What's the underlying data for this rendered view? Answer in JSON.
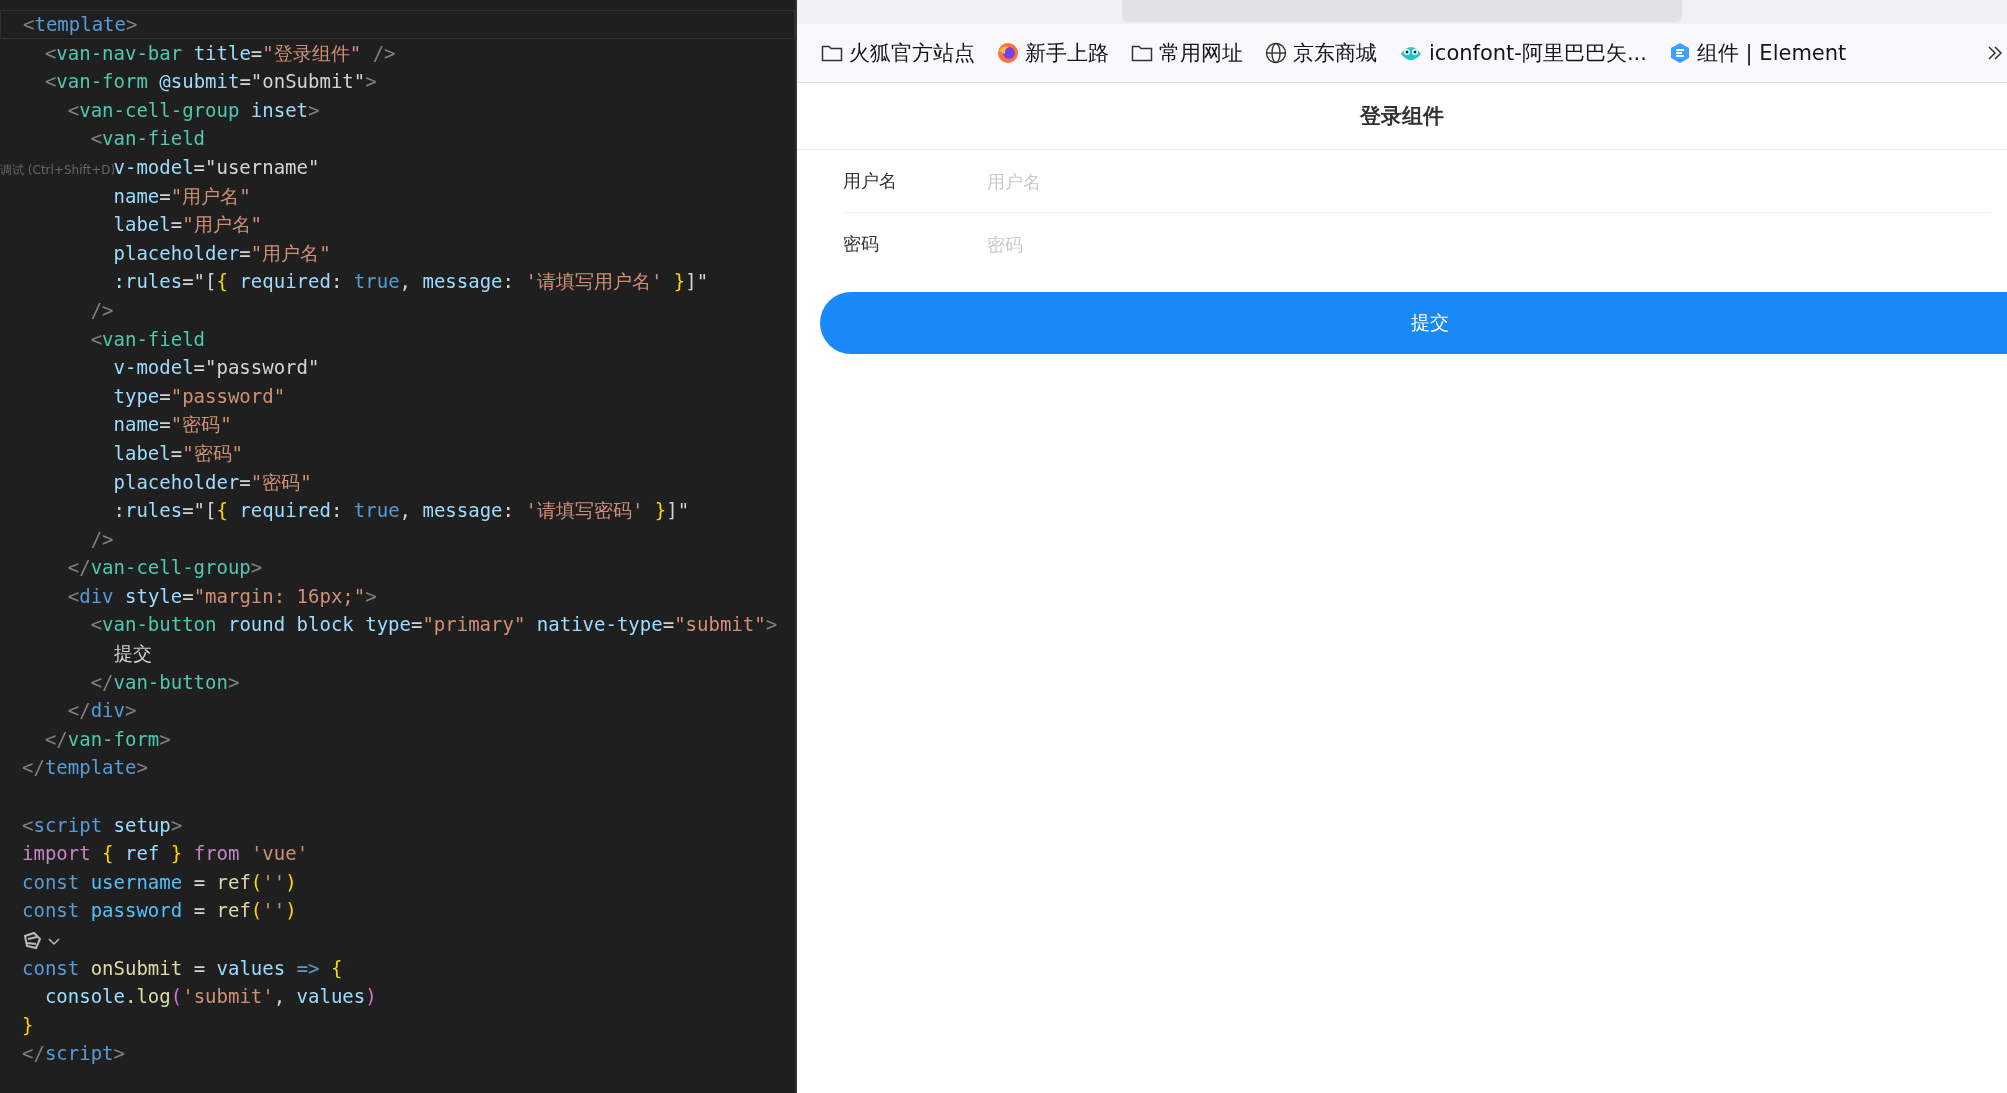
{
  "editor": {
    "tooltip": "调试 (Ctrl+Shift+D)",
    "lines": [
      {
        "current": true,
        "tokens": [
          {
            "kind": "punct",
            "text": "<"
          },
          {
            "kind": "tagb",
            "text": "template"
          },
          {
            "kind": "punct",
            "text": ">"
          }
        ]
      },
      {
        "tokens": [
          {
            "kind": "punct",
            "text": "  <"
          },
          {
            "kind": "tag",
            "text": "van-nav-bar"
          },
          {
            "kind": "attr",
            "text": " title"
          },
          {
            "kind": "plain",
            "text": "="
          },
          {
            "kind": "str",
            "text": "\"登录组件\""
          },
          {
            "kind": "punct",
            "text": " />"
          }
        ]
      },
      {
        "tokens": [
          {
            "kind": "punct",
            "text": "  <"
          },
          {
            "kind": "tag",
            "text": "van-form"
          },
          {
            "kind": "attr",
            "text": " @submit"
          },
          {
            "kind": "plain",
            "text": "=\"onSubmit\""
          },
          {
            "kind": "punct",
            "text": ">"
          }
        ]
      },
      {
        "tokens": [
          {
            "kind": "punct",
            "text": "    <"
          },
          {
            "kind": "tag",
            "text": "van-cell-group"
          },
          {
            "kind": "attr",
            "text": " inset"
          },
          {
            "kind": "punct",
            "text": ">"
          }
        ]
      },
      {
        "tokens": [
          {
            "kind": "punct",
            "text": "      <"
          },
          {
            "kind": "tag",
            "text": "van-field"
          }
        ]
      },
      {
        "tokens": [
          {
            "kind": "attr",
            "text": "        v-model"
          },
          {
            "kind": "plain",
            "text": "=\"username\""
          }
        ]
      },
      {
        "tokens": [
          {
            "kind": "attr",
            "text": "        name"
          },
          {
            "kind": "plain",
            "text": "="
          },
          {
            "kind": "str",
            "text": "\"用户名\""
          }
        ]
      },
      {
        "tokens": [
          {
            "kind": "attr",
            "text": "        label"
          },
          {
            "kind": "plain",
            "text": "="
          },
          {
            "kind": "str",
            "text": "\"用户名\""
          }
        ]
      },
      {
        "tokens": [
          {
            "kind": "attr",
            "text": "        placeholder"
          },
          {
            "kind": "plain",
            "text": "="
          },
          {
            "kind": "str",
            "text": "\"用户名\""
          }
        ]
      },
      {
        "tokens": [
          {
            "kind": "attr",
            "text": "        :rules"
          },
          {
            "kind": "plain",
            "text": "=\"["
          },
          {
            "kind": "brace",
            "text": "{"
          },
          {
            "kind": "attr",
            "text": " required"
          },
          {
            "kind": "plain",
            "text": ":"
          },
          {
            "kind": "kw",
            "text": " true"
          },
          {
            "kind": "plain",
            "text": ","
          },
          {
            "kind": "attr",
            "text": " message"
          },
          {
            "kind": "plain",
            "text": ":"
          },
          {
            "kind": "str",
            "text": " '请填写用户名'"
          },
          {
            "kind": "brace",
            "text": " }"
          },
          {
            "kind": "plain",
            "text": "]\""
          }
        ]
      },
      {
        "tokens": [
          {
            "kind": "punct",
            "text": "      />"
          }
        ]
      },
      {
        "tokens": [
          {
            "kind": "punct",
            "text": "      <"
          },
          {
            "kind": "tag",
            "text": "van-field"
          }
        ]
      },
      {
        "tokens": [
          {
            "kind": "attr",
            "text": "        v-model"
          },
          {
            "kind": "plain",
            "text": "=\"password\""
          }
        ]
      },
      {
        "tokens": [
          {
            "kind": "attr",
            "text": "        type"
          },
          {
            "kind": "plain",
            "text": "="
          },
          {
            "kind": "str",
            "text": "\"password\""
          }
        ]
      },
      {
        "tokens": [
          {
            "kind": "attr",
            "text": "        name"
          },
          {
            "kind": "plain",
            "text": "="
          },
          {
            "kind": "str",
            "text": "\"密码\""
          }
        ]
      },
      {
        "tokens": [
          {
            "kind": "attr",
            "text": "        label"
          },
          {
            "kind": "plain",
            "text": "="
          },
          {
            "kind": "str",
            "text": "\"密码\""
          }
        ]
      },
      {
        "tokens": [
          {
            "kind": "attr",
            "text": "        placeholder"
          },
          {
            "kind": "plain",
            "text": "="
          },
          {
            "kind": "str",
            "text": "\"密码\""
          }
        ]
      },
      {
        "tokens": [
          {
            "kind": "attr",
            "text": "        :rules"
          },
          {
            "kind": "plain",
            "text": "=\"["
          },
          {
            "kind": "brace",
            "text": "{"
          },
          {
            "kind": "attr",
            "text": " required"
          },
          {
            "kind": "plain",
            "text": ":"
          },
          {
            "kind": "kw",
            "text": " true"
          },
          {
            "kind": "plain",
            "text": ","
          },
          {
            "kind": "attr",
            "text": " message"
          },
          {
            "kind": "plain",
            "text": ":"
          },
          {
            "kind": "str",
            "text": " '请填写密码'"
          },
          {
            "kind": "brace",
            "text": " }"
          },
          {
            "kind": "plain",
            "text": "]\""
          }
        ]
      },
      {
        "tokens": [
          {
            "kind": "punct",
            "text": "      />"
          }
        ]
      },
      {
        "tokens": [
          {
            "kind": "punct",
            "text": "    </"
          },
          {
            "kind": "tag",
            "text": "van-cell-group"
          },
          {
            "kind": "punct",
            "text": ">"
          }
        ]
      },
      {
        "tokens": [
          {
            "kind": "punct",
            "text": "    <"
          },
          {
            "kind": "tagb",
            "text": "div"
          },
          {
            "kind": "attr",
            "text": " style"
          },
          {
            "kind": "plain",
            "text": "="
          },
          {
            "kind": "str",
            "text": "\"margin: 16px;\""
          },
          {
            "kind": "punct",
            "text": ">"
          }
        ]
      },
      {
        "tokens": [
          {
            "kind": "punct",
            "text": "      <"
          },
          {
            "kind": "tag",
            "text": "van-button"
          },
          {
            "kind": "attr",
            "text": " round block type"
          },
          {
            "kind": "plain",
            "text": "="
          },
          {
            "kind": "str",
            "text": "\"primary\""
          },
          {
            "kind": "attr",
            "text": " native-type"
          },
          {
            "kind": "plain",
            "text": "="
          },
          {
            "kind": "str",
            "text": "\"submit\""
          },
          {
            "kind": "punct",
            "text": ">"
          }
        ]
      },
      {
        "tokens": [
          {
            "kind": "plain",
            "text": "        提交"
          }
        ]
      },
      {
        "tokens": [
          {
            "kind": "punct",
            "text": "      </"
          },
          {
            "kind": "tag",
            "text": "van-button"
          },
          {
            "kind": "punct",
            "text": ">"
          }
        ]
      },
      {
        "tokens": [
          {
            "kind": "punct",
            "text": "    </"
          },
          {
            "kind": "tagb",
            "text": "div"
          },
          {
            "kind": "punct",
            "text": ">"
          }
        ]
      },
      {
        "tokens": [
          {
            "kind": "punct",
            "text": "  </"
          },
          {
            "kind": "tag",
            "text": "van-form"
          },
          {
            "kind": "punct",
            "text": ">"
          }
        ]
      },
      {
        "tokens": [
          {
            "kind": "punct",
            "text": "</"
          },
          {
            "kind": "tagb",
            "text": "template"
          },
          {
            "kind": "punct",
            "text": ">"
          }
        ]
      },
      {
        "kind": "blank"
      },
      {
        "tokens": [
          {
            "kind": "punct",
            "text": "<"
          },
          {
            "kind": "tagb",
            "text": "script"
          },
          {
            "kind": "attr",
            "text": " setup"
          },
          {
            "kind": "punct",
            "text": ">"
          }
        ]
      },
      {
        "tokens": [
          {
            "kind": "imp",
            "text": "import"
          },
          {
            "kind": "brace",
            "text": " {"
          },
          {
            "kind": "attr",
            "text": " ref"
          },
          {
            "kind": "brace",
            "text": " }"
          },
          {
            "kind": "imp",
            "text": " from"
          },
          {
            "kind": "str",
            "text": " 'vue'"
          }
        ]
      },
      {
        "tokens": [
          {
            "kind": "kw",
            "text": "const"
          },
          {
            "kind": "var",
            "text": " username"
          },
          {
            "kind": "plain",
            "text": " ="
          },
          {
            "kind": "fn",
            "text": " ref"
          },
          {
            "kind": "brace",
            "text": "("
          },
          {
            "kind": "str",
            "text": "''"
          },
          {
            "kind": "brace",
            "text": ")"
          }
        ]
      },
      {
        "tokens": [
          {
            "kind": "kw",
            "text": "const"
          },
          {
            "kind": "var",
            "text": " password"
          },
          {
            "kind": "plain",
            "text": " ="
          },
          {
            "kind": "fn",
            "text": " ref"
          },
          {
            "kind": "brace",
            "text": "("
          },
          {
            "kind": "str",
            "text": "''"
          },
          {
            "kind": "brace",
            "text": ")"
          }
        ]
      },
      {
        "kind": "lens"
      },
      {
        "tokens": [
          {
            "kind": "kw",
            "text": "const"
          },
          {
            "kind": "fn",
            "text": " onSubmit"
          },
          {
            "kind": "plain",
            "text": " ="
          },
          {
            "kind": "attr",
            "text": " values"
          },
          {
            "kind": "kw",
            "text": " =>"
          },
          {
            "kind": "brace",
            "text": " {"
          }
        ]
      },
      {
        "tokens": [
          {
            "kind": "attr",
            "text": "  console"
          },
          {
            "kind": "fn",
            "text": ".log"
          },
          {
            "kind": "paren",
            "text": "("
          },
          {
            "kind": "str",
            "text": "'submit'"
          },
          {
            "kind": "plain",
            "text": ","
          },
          {
            "kind": "attr",
            "text": " values"
          },
          {
            "kind": "paren",
            "text": ")"
          }
        ]
      },
      {
        "tokens": [
          {
            "kind": "brace",
            "text": "}"
          }
        ]
      },
      {
        "tokens": [
          {
            "kind": "punct",
            "text": "</"
          },
          {
            "kind": "tagb",
            "text": "script"
          },
          {
            "kind": "punct",
            "text": ">"
          }
        ]
      }
    ]
  },
  "browser": {
    "bookmarks": [
      {
        "kind": "folder",
        "label": "火狐官方站点"
      },
      {
        "kind": "firefox",
        "label": "新手上路"
      },
      {
        "kind": "folder",
        "label": "常用网址"
      },
      {
        "kind": "globe",
        "label": "京东商城"
      },
      {
        "kind": "iconfont",
        "label": "iconfont-阿里巴巴矢..."
      },
      {
        "kind": "element",
        "label": "组件 | Element"
      }
    ]
  },
  "page": {
    "nav_title": "登录组件",
    "fields": [
      {
        "label": "用户名",
        "placeholder": "用户名"
      },
      {
        "label": "密码",
        "placeholder": "密码"
      }
    ],
    "submit": "提交"
  }
}
